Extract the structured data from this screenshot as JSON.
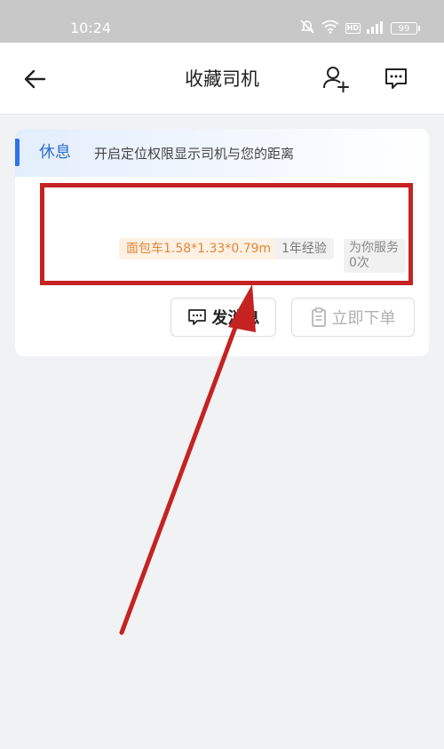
{
  "status_bar": {
    "time": "10:24",
    "battery": "99",
    "hd": "HD"
  },
  "header": {
    "title": "收藏司机"
  },
  "driver_card": {
    "status": "休息",
    "location_hint": "开启定位权限显示司机与您的距离",
    "vehicle_tag": "面包车1.58*1.33*0.79m",
    "experience_tag": "1年经验",
    "service_tag": "为你服务0次",
    "send_message_label": "发消息",
    "place_order_label": "立即下单"
  },
  "colors": {
    "accent_blue": "#2f74e6",
    "highlight_red": "#c52222",
    "vehicle_tag_text": "#e0873b",
    "vehicle_tag_bg": "#fdf1e3"
  },
  "icons": [
    "back-arrow-icon",
    "add-user-icon",
    "message-icon",
    "mute-icon",
    "wifi-icon",
    "signal-icon",
    "battery-icon",
    "chat-icon",
    "clipboard-icon"
  ]
}
